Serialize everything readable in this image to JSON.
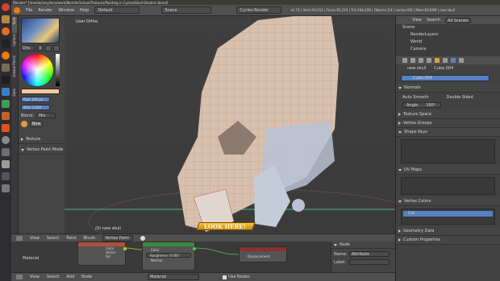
{
  "topbar": {
    "window_title": "Blender* [/media/cesy/tera/work/BlenderSchool/Textures/Painting in Cycles/Skull-Shaders.blend]",
    "menu": [
      "File",
      "Render",
      "Window",
      "Help"
    ],
    "layout": "Default",
    "scene": "Scene",
    "engine": "Cycles Render",
    "stats": "v2.73 | Verts:93,011 | Faces:92,214 | Tris:184,428 | Objects:1/4 | Lamps:0/0 | Mem:83.69M | new skull"
  },
  "tool_tabs": [
    "Tools",
    "Options",
    "Grease Pencil",
    "Slots"
  ],
  "tool_panel": {
    "brush_name": "Dra",
    "brush_users": "3",
    "radius": "Rad: 105 px",
    "strength": "Stre: 1.000",
    "blend_label": "Blend:",
    "blend_value": "Mix",
    "new_label": "New",
    "texture_label": "Texture",
    "mode_label": "Vertex Paint Mode"
  },
  "viewport": {
    "view_label": "User Ortho",
    "object_label": "(0) new skull",
    "watermark": "LOOK HERE!"
  },
  "viewport_header": {
    "menu": [
      "View",
      "Select",
      "Paint",
      "Brush"
    ],
    "mode": "Vertex Paint"
  },
  "outliner": {
    "tabs": [
      "View",
      "Search",
      "All Scenes"
    ],
    "items": [
      "Scene",
      "RenderLayers",
      "World",
      "Camera"
    ]
  },
  "properties": {
    "breadcrumb_obj": "new skull",
    "breadcrumb_mesh": "Cube.004",
    "mesh_name": "Cube.004",
    "normals": "Normals",
    "auto_smooth": "Auto Smooth",
    "double_sided": "Double Sided",
    "angle_label": "Angle",
    "angle_value": "180°",
    "texture_space": "Texture Space",
    "vertex_groups": "Vertex Groups",
    "shape_keys": "Shape Keys",
    "uv_maps": "UV Maps",
    "vertex_colors": "Vertex Colors",
    "col_layer": "Col",
    "geometry_data": "Geometry Data",
    "custom_props": "Custom Properties"
  },
  "node_editor": {
    "material_label": "Material",
    "n1_rows": [
      "Color",
      "Vector",
      "Fac"
    ],
    "n2_rows": [
      "Color",
      "Roughness: 0.000",
      "Normal"
    ],
    "n3_row": "Displacement",
    "side_title": "Node",
    "name_label": "Name:",
    "name_value": "Attribute",
    "label_label": "Label:"
  },
  "node_header": {
    "menu": [
      "View",
      "Select",
      "Add",
      "Node"
    ],
    "material": "Material",
    "use_nodes": "Use Nodes"
  },
  "colors": {
    "swatch": "#ffc8a0",
    "accent": "#5680c2"
  }
}
